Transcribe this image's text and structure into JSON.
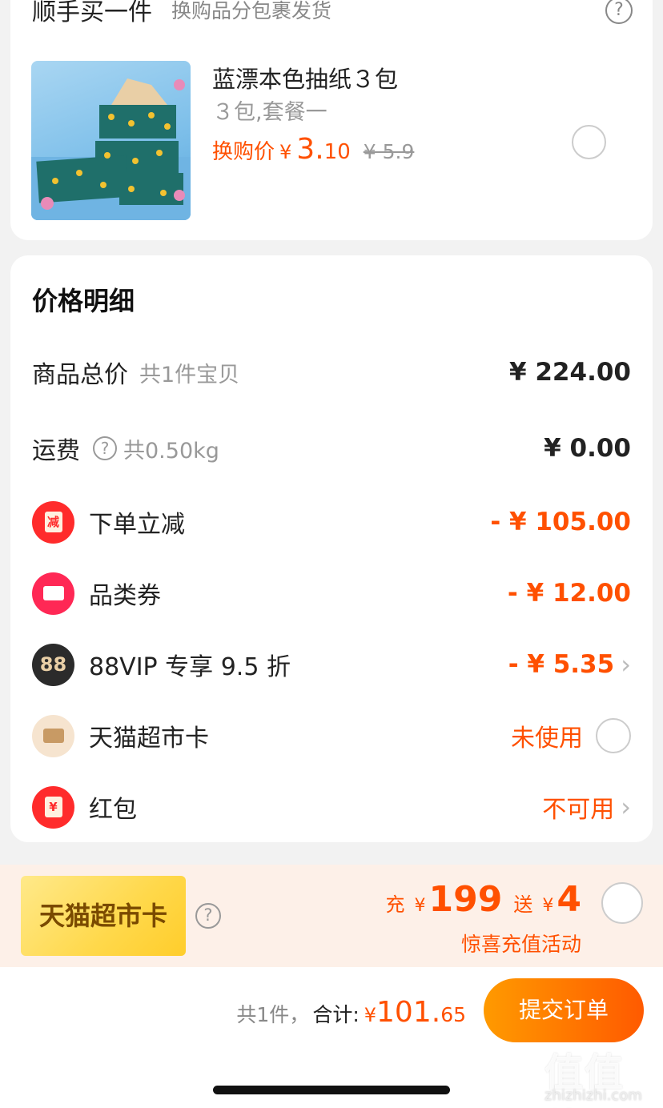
{
  "addon": {
    "title": "顺手买一件",
    "subtitle": "换购品分包裹发货",
    "product": {
      "name": "蓝漂本色抽纸３包",
      "spec": "３包,套餐一",
      "price_label": "换购价",
      "currency": "¥",
      "price_int": "3.",
      "price_dec": "10",
      "original_price": "¥ 5.9"
    }
  },
  "detail": {
    "title": "价格明细",
    "rows": [
      {
        "label": "商品总价",
        "sub": "共1件宝贝",
        "value": "¥ 224.00"
      },
      {
        "label": "运费",
        "sub": "共0.50kg",
        "value": "¥ 0.00"
      },
      {
        "label": "下单立减",
        "badge_text": "减",
        "value": "- ¥ 105.00"
      },
      {
        "label": "品类券",
        "value": "- ¥ 12.00"
      },
      {
        "label": "88VIP 专享 9.5 折",
        "badge_text": "88",
        "value": "- ¥ 5.35"
      },
      {
        "label": "天猫超市卡",
        "value": "未使用"
      },
      {
        "label": "红包",
        "badge_text": "¥",
        "value": "不可用"
      }
    ]
  },
  "promo": {
    "card_text": "天猫超市卡",
    "charge_label": "充",
    "charge_yen": "¥",
    "charge_amount": "199",
    "gift_label": "送",
    "gift_yen": "¥",
    "gift_amount": "4",
    "caption": "惊喜充值活动"
  },
  "footer": {
    "count": "共1件，",
    "total_label": "合计:",
    "currency": "¥",
    "total_int": "101.",
    "total_dec": "65",
    "submit_label": "提交订单"
  },
  "watermark": {
    "logo": "值值值",
    "url": "zhizhizhi.com"
  },
  "colors": {
    "accent": "#ff5000",
    "button_start": "#ff9a00",
    "button_end": "#ff5a00",
    "promo_bg": "#fdf0e8"
  }
}
